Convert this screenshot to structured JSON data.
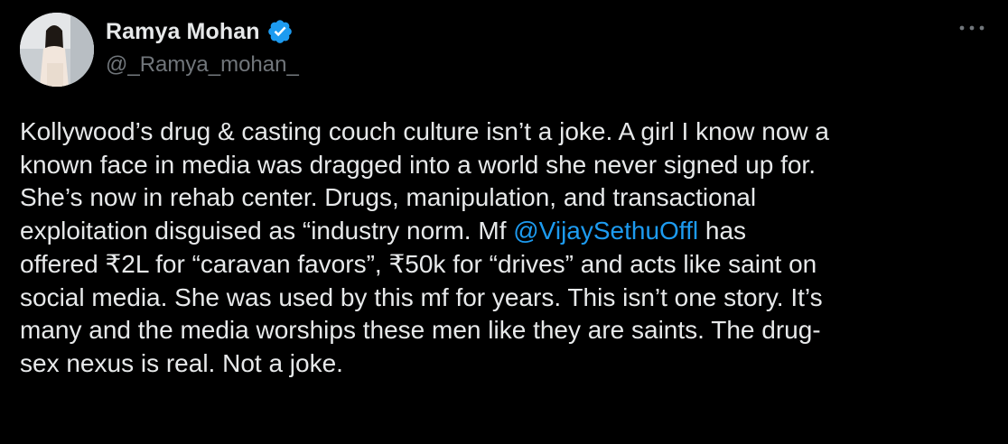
{
  "author": {
    "display_name": "Ramya Mohan",
    "handle": "@_Ramya_mohan_",
    "verified": true,
    "verified_color": "#1d9bf0"
  },
  "icons": {
    "verified": "verified-badge-icon",
    "more": "more-options-icon"
  },
  "colors": {
    "background": "#000000",
    "text": "#e7e9ea",
    "secondary": "#71767b",
    "link": "#1d9bf0"
  },
  "tweet": {
    "lines": [
      "Kollywood’s drug & casting couch culture isn’t a joke. A girl I know now a",
      "known face in media was dragged into a world she never signed up for.",
      "She’s now in  rehab center. Drugs, manipulation, and transactional",
      "exploitation disguised as “industry norm. Mf ",
      "offered ₹2L for “caravan favors”, ₹50k for “drives” and acts like saint on",
      "social media. She was used by this mf for years. This isn’t one story. It’s",
      "many and the media worships these men like they are saints. The drug-",
      "sex nexus is real. Not a joke."
    ],
    "mention": "@VijaySethuOffl",
    "line4_after_mention": " has"
  }
}
